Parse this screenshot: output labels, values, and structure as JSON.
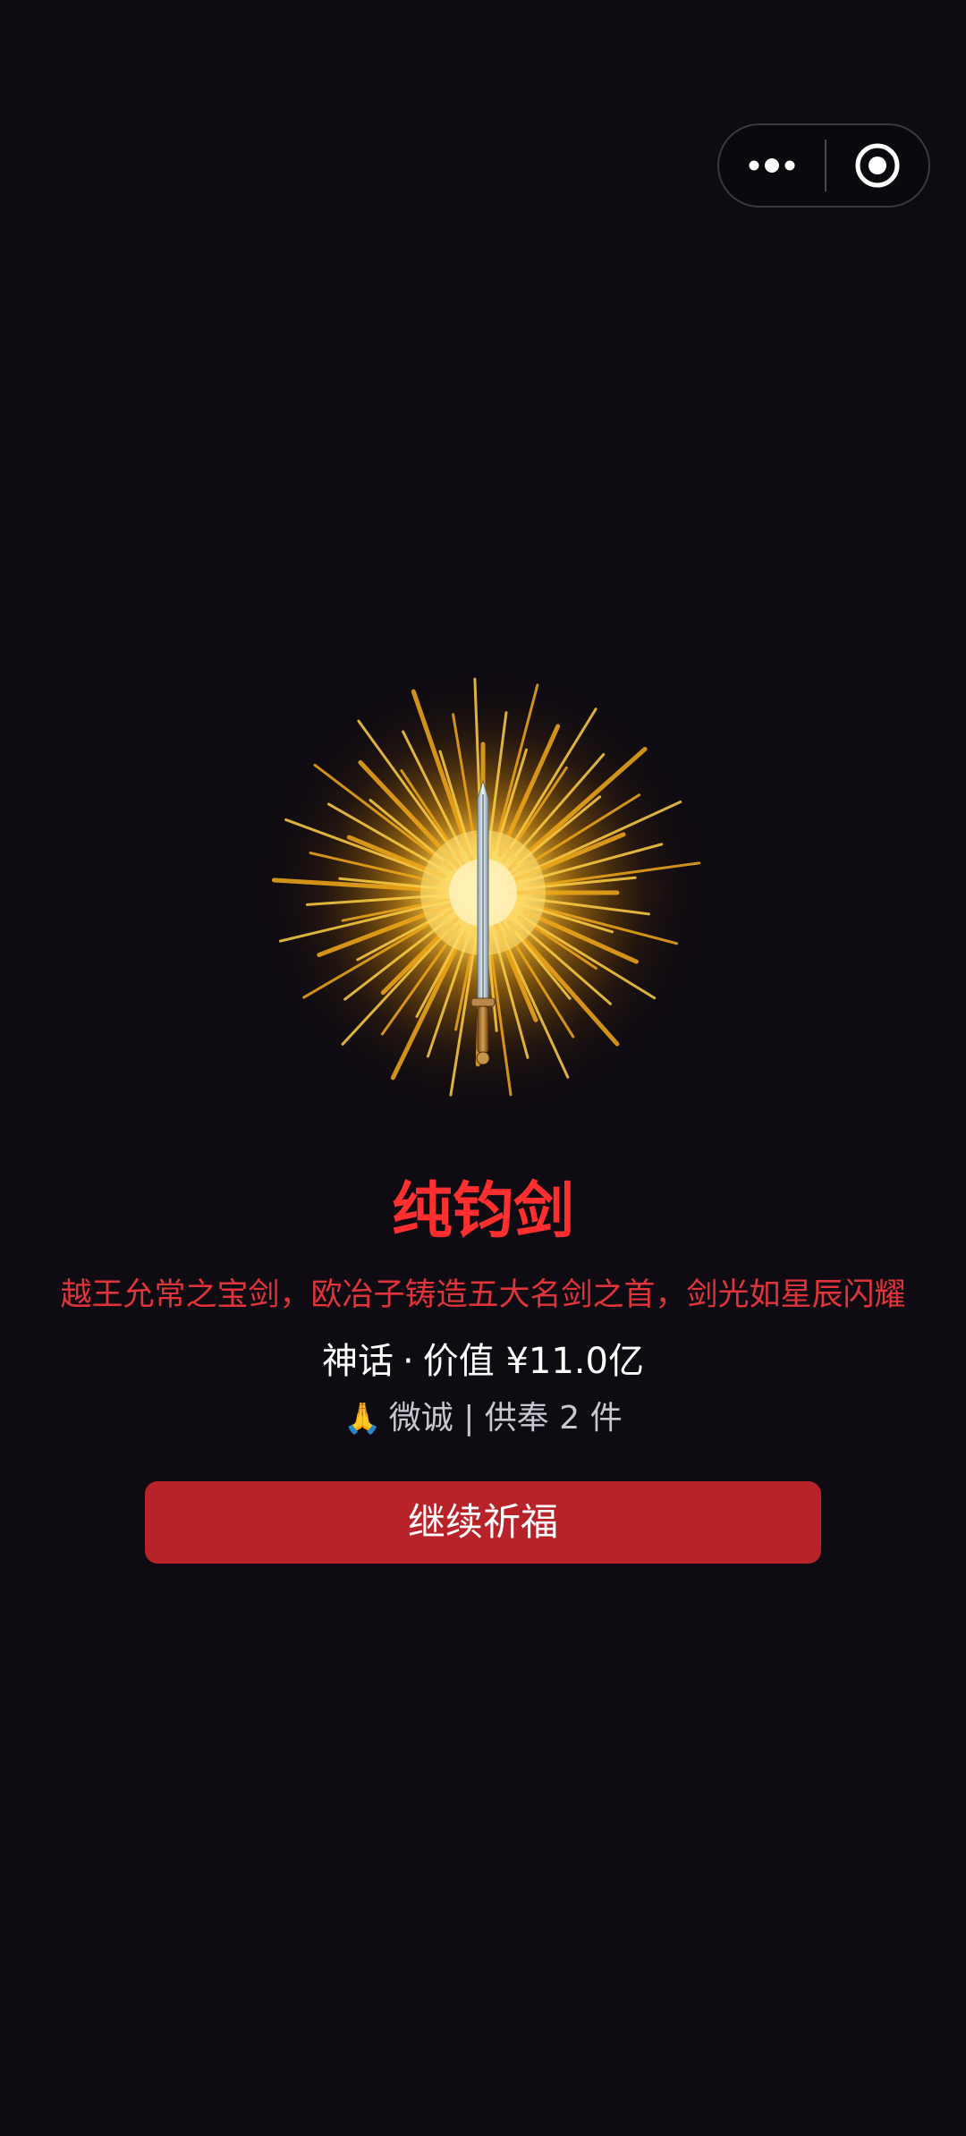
{
  "capsule": {
    "more_icon": "more-dots-icon",
    "close_icon": "target-circle-icon"
  },
  "item": {
    "image_icon": "sword-burst-icon",
    "name": "纯钧剑",
    "description": "越王允常之宝剑，欧冶子铸造五大名剑之首，剑光如星辰闪耀",
    "rarity": "神话",
    "separator": "·",
    "value_text": "价值 ¥11.0亿",
    "offer_emoji": "🙏",
    "offer_text": "微诚 | 供奉 2 件"
  },
  "actions": {
    "continue_label": "继续祈福"
  },
  "colors": {
    "background": "#0e0b12",
    "title": "#ff2f2f",
    "description": "#e0343a",
    "button": "#b8232a",
    "gold": "#ffc93a"
  }
}
